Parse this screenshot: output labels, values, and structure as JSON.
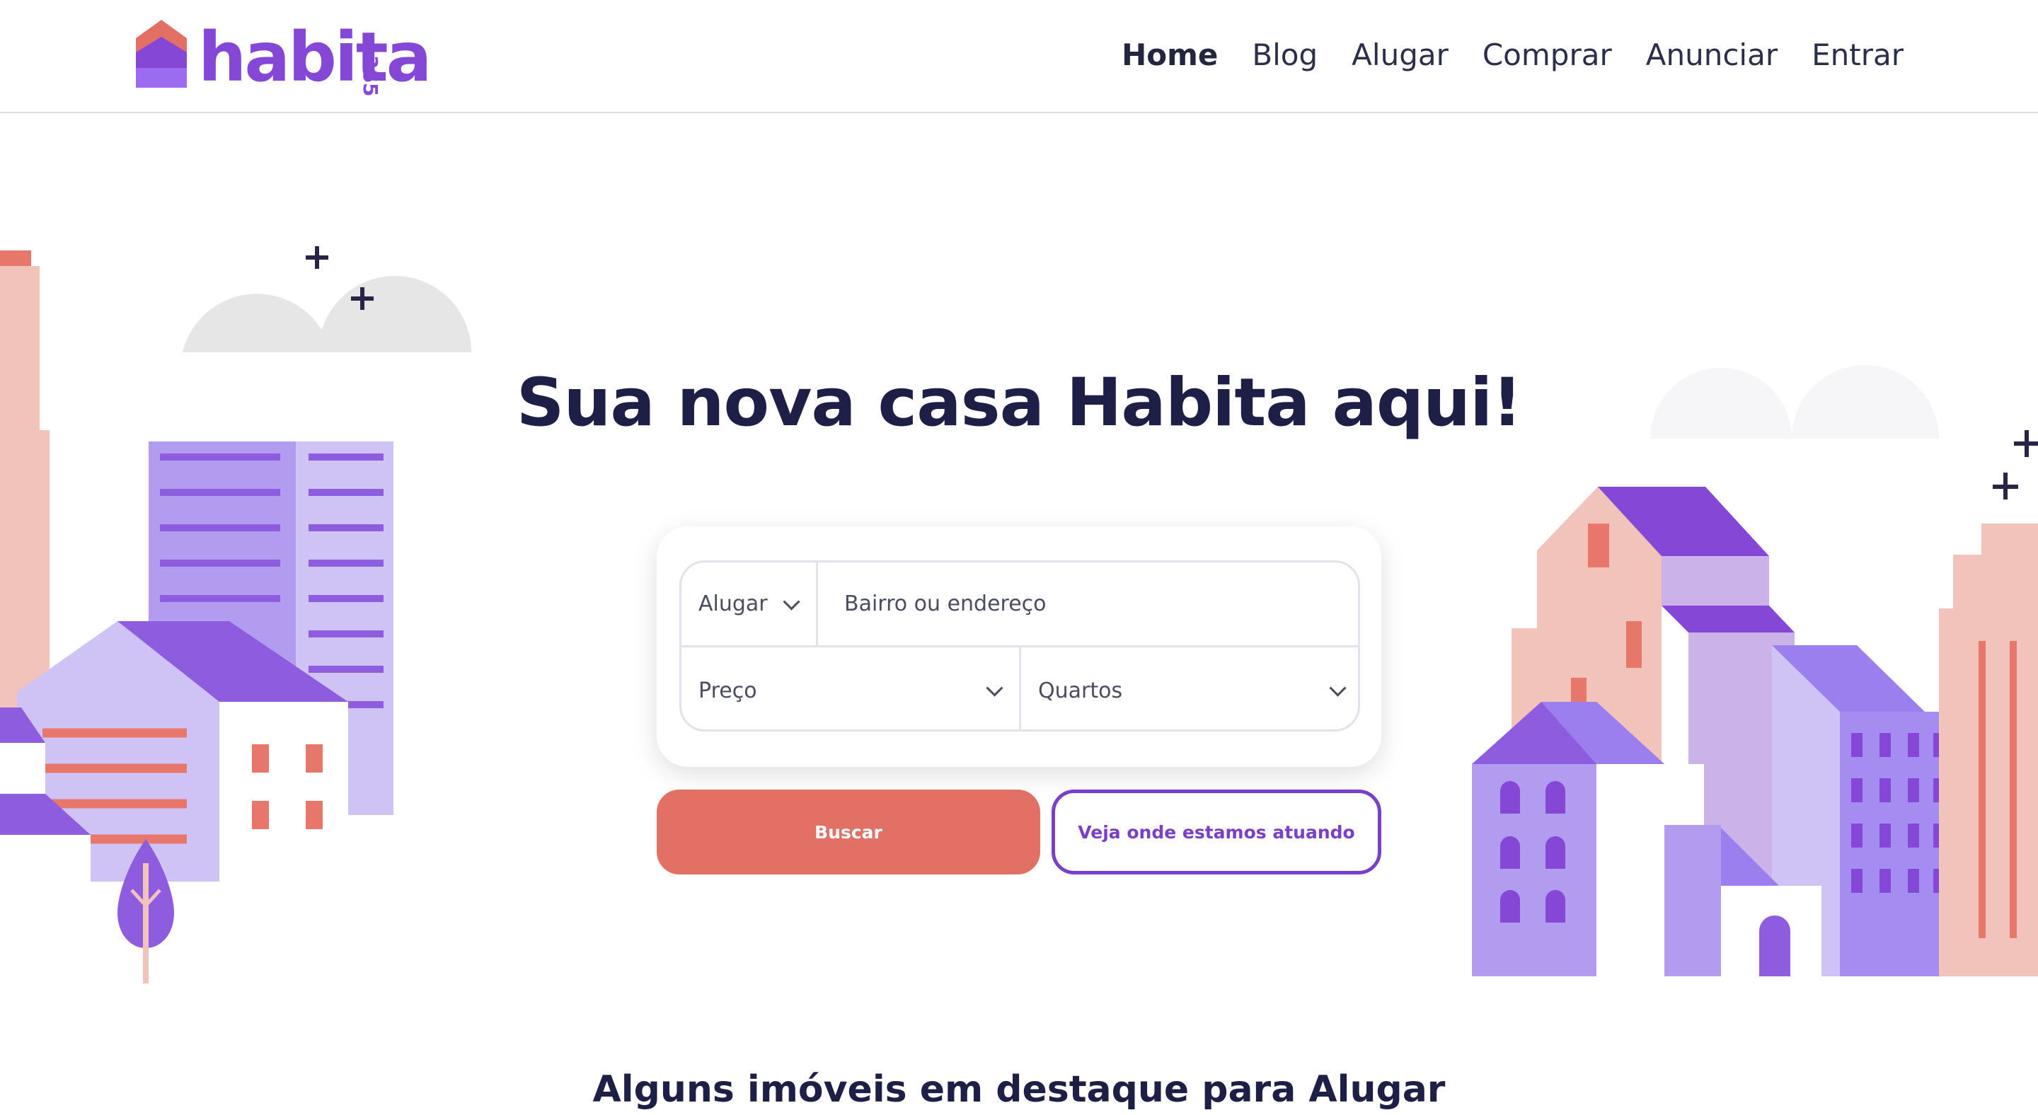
{
  "header": {
    "logo_text": "habita",
    "logo_number": "365",
    "nav": [
      {
        "label": "Home",
        "active": true
      },
      {
        "label": "Blog",
        "active": false
      },
      {
        "label": "Alugar",
        "active": false
      },
      {
        "label": "Comprar",
        "active": false
      },
      {
        "label": "Anunciar",
        "active": false
      },
      {
        "label": "Entrar",
        "active": false
      }
    ]
  },
  "hero": {
    "title": "Sua nova casa Habita aqui!"
  },
  "search": {
    "type_value": "Alugar",
    "address_placeholder": "Bairro ou endereço",
    "price_value": "Preço",
    "rooms_value": "Quartos"
  },
  "buttons": {
    "search_label": "Buscar",
    "locations_label": "Veja onde estamos atuando"
  },
  "featured": {
    "title": "Alguns imóveis em destaque para Alugar"
  },
  "colors": {
    "brand_purple": "#8447d6",
    "coral": "#e37065",
    "navy": "#1e1f47"
  },
  "icons": [
    "house-logo-icon",
    "chevron-down-icon",
    "sparkle-icon",
    "cloud-icon",
    "tree-icon"
  ]
}
